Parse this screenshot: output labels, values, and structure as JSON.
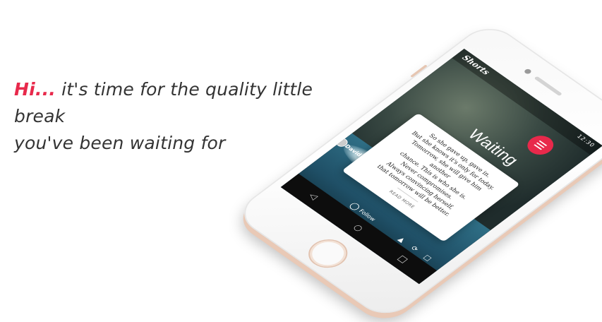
{
  "headline": {
    "hi": "Hi...",
    "line1": " it's time for the quality little break",
    "line2": "you've been waiting for"
  },
  "app": {
    "logo": "Shorts",
    "status_time": "12:30",
    "story_title": "Waiting",
    "story_lines": [
      "So she gave up, gave in.",
      "But she knows it's only for today.",
      "Tomorrow, she will give him another",
      "chance. This is who she is.",
      "Never compromises.",
      "Always convincing herself,",
      "that tomorrow will be better."
    ],
    "read_more": "READ MORE",
    "author": "David E.",
    "follow_label": "Follow"
  },
  "colors": {
    "accent": "#e8294b",
    "text": "#333333"
  }
}
